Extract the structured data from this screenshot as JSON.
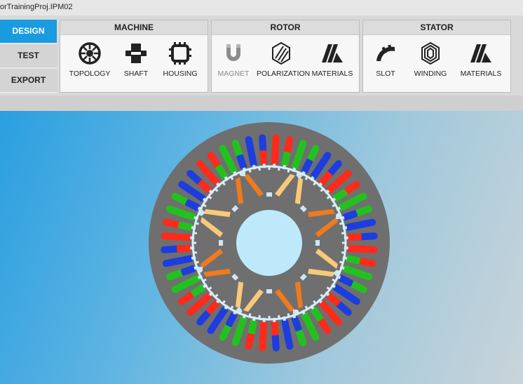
{
  "window": {
    "title": "orTrainingProj.IPM02"
  },
  "modes": [
    {
      "label": "DESIGN",
      "active": true
    },
    {
      "label": "TEST",
      "active": false
    },
    {
      "label": "EXPORT",
      "active": false
    }
  ],
  "groups": {
    "machine": {
      "title": "MACHINE",
      "tools": [
        {
          "label": "TOPOLOGY",
          "icon": "topology-icon"
        },
        {
          "label": "SHAFT",
          "icon": "shaft-icon"
        },
        {
          "label": "HOUSING",
          "icon": "housing-icon"
        }
      ]
    },
    "rotor": {
      "title": "ROTOR",
      "tools": [
        {
          "label": "MAGNET",
          "icon": "magnet-icon",
          "disabled": true
        },
        {
          "label": "POLARIZATION",
          "icon": "polarization-icon"
        },
        {
          "label": "MATERIALS",
          "icon": "materials-icon"
        }
      ]
    },
    "stator": {
      "title": "STATOR",
      "tools": [
        {
          "label": "SLOT",
          "icon": "slot-icon"
        },
        {
          "label": "WINDING",
          "icon": "winding-icon"
        },
        {
          "label": "MATERIALS",
          "icon": "materials-icon"
        }
      ]
    }
  },
  "colors": {
    "accent": "#1a9be0",
    "stator": "#6f6f6f",
    "phase_red": "#ff2a1a",
    "phase_green": "#22c21e",
    "phase_blue": "#1c3de0",
    "magnet_orange": "#f07a1e",
    "magnet_light": "#f9c97a",
    "shaft": "#bde9fb"
  }
}
